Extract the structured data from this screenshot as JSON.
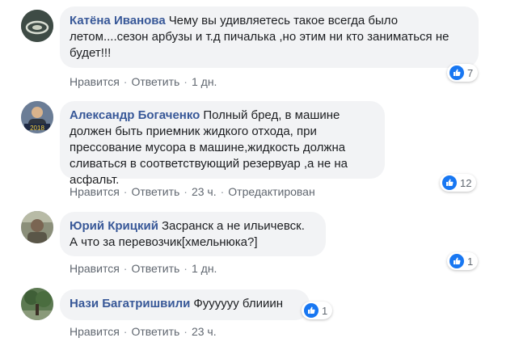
{
  "comments": [
    {
      "author": "Катёна Иванова",
      "text": "Чему вы удивляетесь такое всегда было летом....сезон арбузы и т.д пичалька ,но этим ни кто заниматься не будет!!!",
      "like": "Нравится",
      "reply": "Ответить",
      "time": "1 дн.",
      "reaction_count": "7",
      "reaction_icon": "like-icon"
    },
    {
      "author": "Александр Богаченко",
      "text": "Полный бред, в машине должен быть приемник жидкого отхода, при прессование мусора в машине,жидкость должна сливаться в соответствующий резервуар ,а не на асфальт.",
      "like": "Нравится",
      "reply": "Ответить",
      "time": "23 ч.",
      "edited": "Отредактирован",
      "reaction_count": "12",
      "reaction_icon": "like-icon"
    },
    {
      "author": "Юрий Крицкий",
      "text": "Засранск а не ильичевск. А что за перевозчик[хмельнюка?]",
      "like": "Нравится",
      "reply": "Ответить",
      "time": "1 дн.",
      "reaction_count": "1",
      "reaction_icon": "like-icon"
    },
    {
      "author": "Нази Багатришвили",
      "text": "Фуууууу блииин",
      "like": "Нравится",
      "reply": "Ответить",
      "time": "23 ч.",
      "reaction_count": "1",
      "reaction_icon": "like-icon"
    }
  ],
  "colors": {
    "author": "#385898",
    "bubble": "#f2f3f5",
    "meta": "#606770",
    "like_blue": "#1877f2"
  }
}
